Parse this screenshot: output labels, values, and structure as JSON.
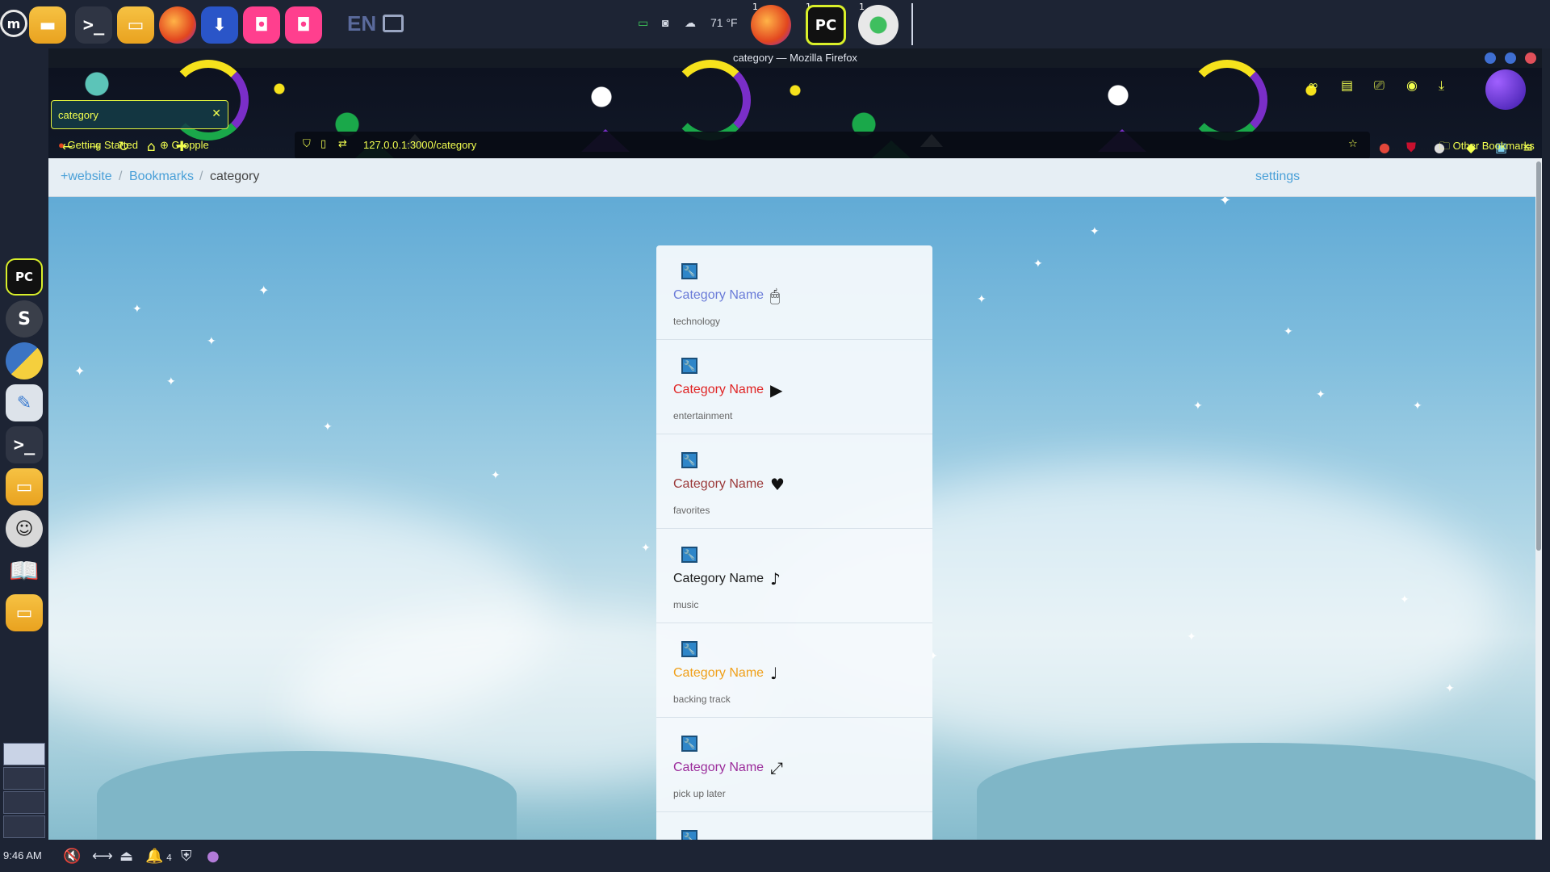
{
  "system_panel": {
    "mint_logo": "mint-icon",
    "pinned_apps": [
      "files-icon",
      "terminal-icon",
      "file-manager-icon",
      "firefox-icon",
      "download-manager-icon",
      "store-icon",
      "store-icon"
    ],
    "language": "EN",
    "weather": "71 °F",
    "running_apps": [
      {
        "icon": "firefox-icon",
        "badge": "1"
      },
      {
        "icon": "pycharm-icon",
        "badge": "1",
        "label": "PC"
      },
      {
        "icon": "disk-usage-icon",
        "badge": "1"
      }
    ]
  },
  "dock": {
    "items": [
      "pycharm-icon",
      "sublime-icon",
      "python-icon",
      "feather-icon",
      "terminal-icon",
      "files-icon",
      "sunglasses-icon",
      "book-icon",
      "files-icon"
    ]
  },
  "bottom_panel": {
    "time": "9:46 AM",
    "notification_count": "4"
  },
  "window": {
    "title": "category — Mozilla Firefox",
    "tab_label": "category",
    "url": "127.0.0.1:3000/category",
    "bookmarks": [
      {
        "label": "Getting Started"
      },
      {
        "label": "Gropple"
      }
    ],
    "other_bookmarks": "Other Bookmarks"
  },
  "page": {
    "breadcrumb": {
      "root": "+website",
      "bookmarks": "Bookmarks",
      "current": "category",
      "separator": "/"
    },
    "settings": "settings",
    "categories": [
      {
        "name": "Category Name",
        "slug": "technology",
        "icon": "mouse-icon",
        "icon_glyph": "🖱",
        "color": "#6a7bd8"
      },
      {
        "name": "Category Name",
        "slug": "entertainment",
        "icon": "tv-play-icon",
        "icon_glyph": "▶",
        "color": "#e02424"
      },
      {
        "name": "Category Name",
        "slug": "favorites",
        "icon": "heart-icon",
        "icon_glyph": "♥",
        "color": "#9b3a3a"
      },
      {
        "name": "Category Name",
        "slug": "music",
        "icon": "music-note-icon",
        "icon_glyph": "♪",
        "color": "#222222"
      },
      {
        "name": "Category Name",
        "slug": "backing track",
        "icon": "music-note-icon",
        "icon_glyph": "♩",
        "color": "#f0a01a"
      },
      {
        "name": "Category Name",
        "slug": "pick up later",
        "icon": "arrow-diagonal-icon",
        "icon_glyph": "⤢",
        "color": "#9b2c9b"
      }
    ]
  }
}
